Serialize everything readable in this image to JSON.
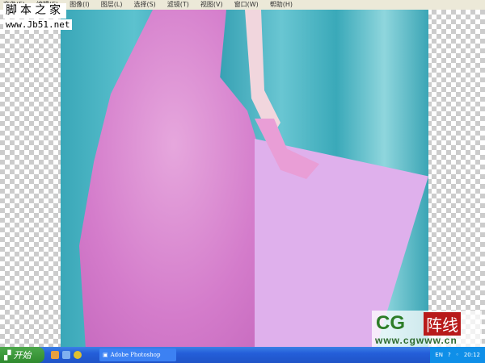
{
  "menu": [
    "文件(F)",
    "编辑(E)",
    "图像(I)",
    "图层(L)",
    "选择(S)",
    "滤镜(T)",
    "视图(V)",
    "窗口(W)",
    "帮助(H)"
  ],
  "watermark": {
    "site_name": "脚本之家",
    "site_url": "www.Jb51.net"
  },
  "logo": {
    "letters": "CG",
    "chinese": "阵线",
    "url": "www.cgwww.cn"
  },
  "taskbar": {
    "start_label": "开始",
    "task_label": "Adobe Photoshop",
    "lang": "EN",
    "clock": "20:12"
  }
}
